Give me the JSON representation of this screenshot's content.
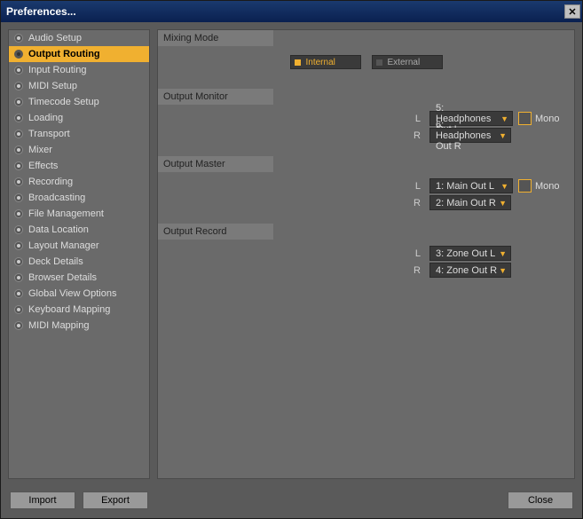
{
  "title": "Preferences...",
  "sidebar": {
    "items": [
      {
        "label": "Audio Setup"
      },
      {
        "label": "Output Routing"
      },
      {
        "label": "Input Routing"
      },
      {
        "label": "MIDI Setup"
      },
      {
        "label": "Timecode Setup"
      },
      {
        "label": "Loading"
      },
      {
        "label": "Transport"
      },
      {
        "label": "Mixer"
      },
      {
        "label": "Effects"
      },
      {
        "label": "Recording"
      },
      {
        "label": "Broadcasting"
      },
      {
        "label": "File Management"
      },
      {
        "label": "Data Location"
      },
      {
        "label": "Layout Manager"
      },
      {
        "label": "Deck Details"
      },
      {
        "label": "Browser Details"
      },
      {
        "label": "Global View Options"
      },
      {
        "label": "Keyboard Mapping"
      },
      {
        "label": "MIDI Mapping"
      }
    ],
    "selected_index": 1
  },
  "sections": {
    "mixing_mode": {
      "title": "Mixing Mode",
      "options": {
        "internal": "Internal",
        "external": "External"
      },
      "active": "internal"
    },
    "output_monitor": {
      "title": "Output Monitor",
      "left_label": "L",
      "right_label": "R",
      "left_value": "5: Headphones Out L",
      "right_value": "6: Headphones Out R",
      "mono_label": "Mono"
    },
    "output_master": {
      "title": "Output Master",
      "left_label": "L",
      "right_label": "R",
      "left_value": "1: Main Out L",
      "right_value": "2: Main Out R",
      "mono_label": "Mono"
    },
    "output_record": {
      "title": "Output Record",
      "left_label": "L",
      "right_label": "R",
      "left_value": "3: Zone Out L",
      "right_value": "4: Zone Out R"
    }
  },
  "footer": {
    "import": "Import",
    "export": "Export",
    "close": "Close"
  }
}
